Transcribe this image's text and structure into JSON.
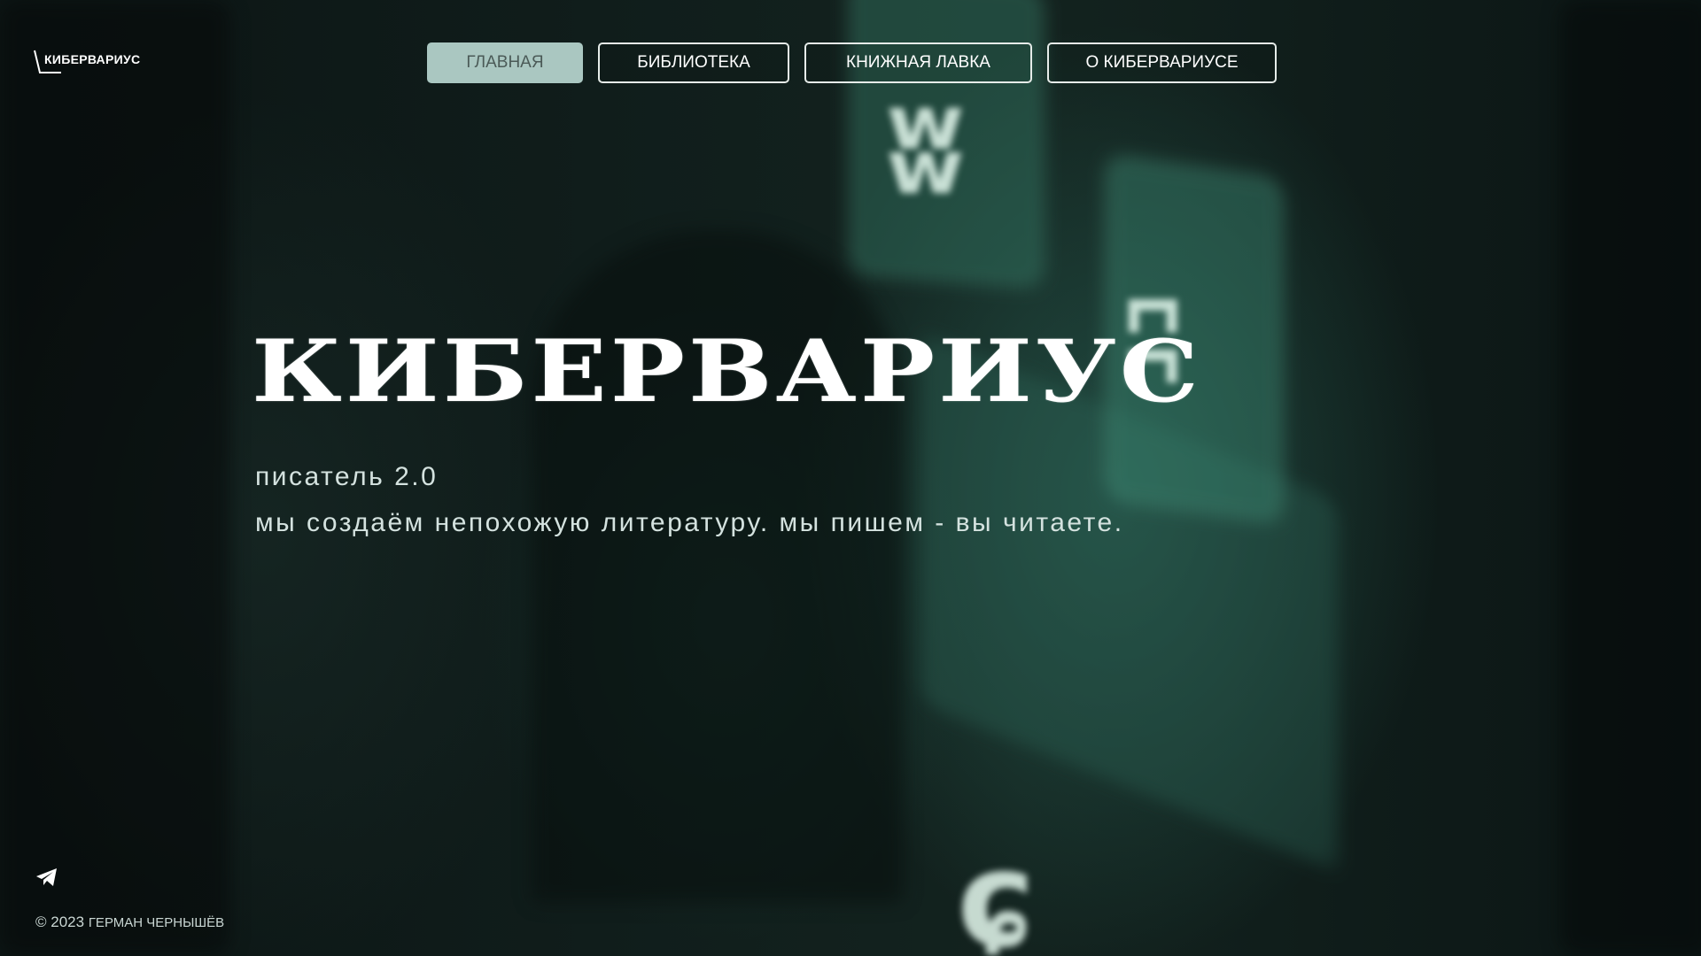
{
  "logo": {
    "text": "КИБЕРВАРИУС",
    "icon": "logo-slash-mark"
  },
  "nav": {
    "items": [
      {
        "label": "ГЛАВНАЯ",
        "active": true
      },
      {
        "label": "БИБЛИОТЕКА",
        "active": false
      },
      {
        "label": "КНИЖНАЯ ЛАВКА",
        "active": false
      },
      {
        "label": "О КИБЕРВАРИУСЕ",
        "active": false
      }
    ],
    "active_color": "#aac7c1"
  },
  "hero": {
    "title": "КИБЕРВАРИУС",
    "subtitle": "писатель 2.0",
    "tagline": "мы создаём непохожую литературу. мы пишем - вы читаете."
  },
  "footer": {
    "social_icon": "telegram-icon",
    "copyright_prefix": "© 2023",
    "copyright_author": "ГЕРМАН ЧЕРНЫШЁВ"
  },
  "colors": {
    "background": "#0b1413",
    "accent_glow": "#3a8a74"
  }
}
